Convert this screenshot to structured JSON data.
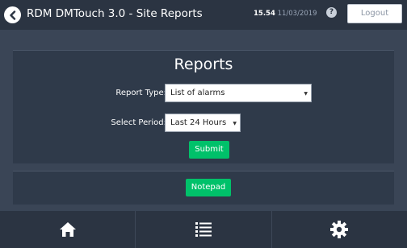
{
  "header": {
    "title": "RDM DMTouch 3.0 - Site Reports",
    "time": "15.54",
    "date": "11/03/2019",
    "help_label": "?",
    "logout_label": "Logout"
  },
  "reports": {
    "title": "Reports",
    "report_type_label": "Report Type:",
    "report_type_value": "List of alarms",
    "period_label": "Select Period:",
    "period_value": "Last 24 Hours",
    "submit_label": "Submit"
  },
  "notepad": {
    "label": "Notepad"
  },
  "nav": {
    "items": [
      {
        "icon": "home-icon"
      },
      {
        "icon": "list-icon"
      },
      {
        "icon": "gear-icon"
      }
    ]
  },
  "colors": {
    "background": "#3a4556",
    "panel": "#2f3a4a",
    "header": "#2b3442",
    "accent_green": "#00c16a"
  }
}
